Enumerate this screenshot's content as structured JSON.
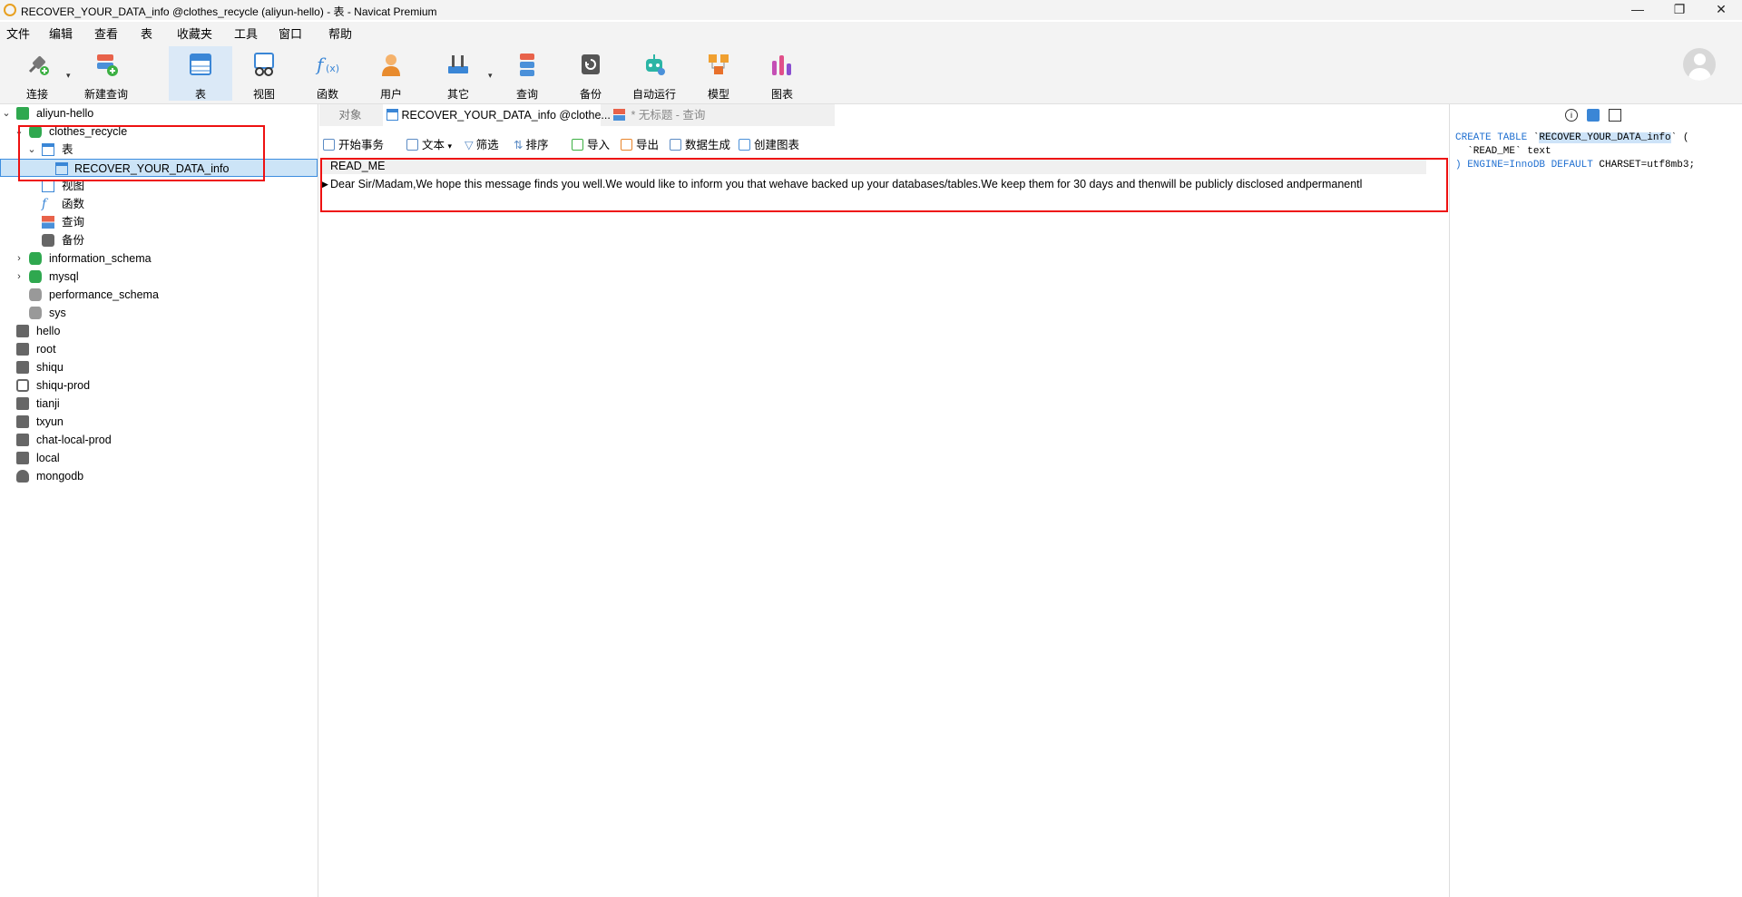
{
  "window": {
    "title": "RECOVER_YOUR_DATA_info @clothes_recycle (aliyun-hello) - 表 - Navicat Premium",
    "minimize": "—",
    "restore": "❐",
    "close": "✕"
  },
  "menu": [
    "文件",
    "编辑",
    "查看",
    "表",
    "收藏夹",
    "工具",
    "窗口",
    "帮助"
  ],
  "toolbar": {
    "connect": "连接",
    "new_query": "新建查询",
    "table": "表",
    "view": "视图",
    "function": "函数",
    "user": "用户",
    "other": "其它",
    "query": "查询",
    "backup": "备份",
    "automation": "自动运行",
    "model": "模型",
    "chart": "图表"
  },
  "tree": {
    "connection": "aliyun-hello",
    "database": "clothes_recycle",
    "tables_node": "表",
    "table_item": "RECOVER_YOUR_DATA_info",
    "views_node": "视图",
    "functions_node": "函数",
    "queries_node": "查询",
    "backups_node": "备份",
    "other_dbs": [
      "information_schema",
      "mysql",
      "performance_schema",
      "sys"
    ],
    "connections": [
      "hello",
      "root",
      "shiqu",
      "shiqu-prod",
      "tianji",
      "txyun",
      "chat-local-prod",
      "local",
      "mongodb"
    ]
  },
  "tabs": {
    "objects": "对象",
    "table_tab": "RECOVER_YOUR_DATA_info @clothe...",
    "query_tab": "* 无标题 - 查询"
  },
  "data_toolbar": {
    "begin_transaction": "开始事务",
    "text": "文本",
    "filter": "筛选",
    "sort": "排序",
    "import": "导入",
    "export": "导出",
    "generate_data": "数据生成",
    "create_chart": "创建图表"
  },
  "grid": {
    "column": "READ_ME",
    "row_value": "Dear Sir/Madam,We hope this message finds you well.We would like to inform you that wehave backed up your databases/tables.We keep them for 30 days and thenwill be publicly disclosed andpermanentl"
  },
  "ddl": {
    "kw_create": "CREATE TABLE",
    "table_name": "RECOVER_YOUR_DATA_info",
    "open_rest": "` (",
    "line2": "  `READ_ME` text",
    "kw_engine": ") ENGINE=InnoDB DEFAULT",
    "charset": " CHARSET=utf8mb3;"
  },
  "colors": {
    "accent": "#3d8ee0",
    "highlight_red": "#e11",
    "keyword_blue": "#1f6fd0",
    "selected_bg": "#cce4f7"
  }
}
